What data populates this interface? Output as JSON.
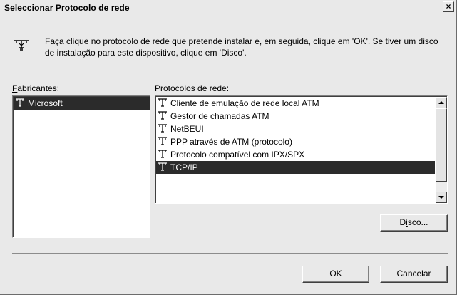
{
  "window": {
    "title": "Seleccionar Protocolo de rede",
    "close_glyph": "×"
  },
  "description": {
    "icon": "network-protocol-icon",
    "text": "Faça clique no protocolo de rede que pretende instalar e, em seguida, clique em 'OK'. Se tiver um disco de instalação para este dispositivo, clique em 'Disco'."
  },
  "manufacturers": {
    "label_accel": "F",
    "label_rest": "abricantes:",
    "items": [
      {
        "label": "Microsoft",
        "icon": "network-protocol-icon",
        "selected": true
      }
    ]
  },
  "protocols": {
    "label": "Protocolos de rede:",
    "items": [
      {
        "label": "Cliente de emulação de rede local ATM",
        "icon": "network-protocol-icon",
        "selected": false
      },
      {
        "label": "Gestor de chamadas ATM",
        "icon": "network-protocol-icon",
        "selected": false
      },
      {
        "label": "NetBEUI",
        "icon": "network-protocol-icon",
        "selected": false
      },
      {
        "label": "PPP através de ATM (protocolo)",
        "icon": "network-protocol-icon",
        "selected": false
      },
      {
        "label": "Protocolo compatível com IPX/SPX",
        "icon": "network-protocol-icon",
        "selected": false
      },
      {
        "label": "TCP/IP",
        "icon": "network-protocol-icon",
        "selected": true
      }
    ]
  },
  "buttons": {
    "disk_pre": "D",
    "disk_accel": "i",
    "disk_post": "sco...",
    "ok": "OK",
    "cancel": "Cancelar"
  }
}
